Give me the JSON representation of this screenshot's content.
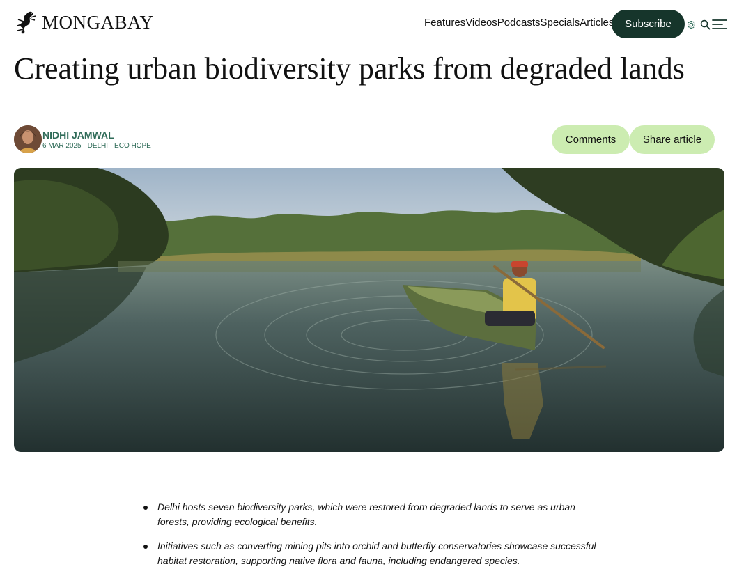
{
  "header": {
    "logo_text": "MONGABAY",
    "nav": [
      "Features",
      "Videos",
      "Podcasts",
      "Specials",
      "Articles"
    ],
    "subscribe_label": "Subscribe",
    "icons": [
      "gear-icon",
      "search-icon",
      "menu-icon"
    ]
  },
  "article": {
    "title": "Creating urban biodiversity parks from degraded lands",
    "author": "NIDHI JAMWAL",
    "date": "6 MAR 2025",
    "tags": [
      "DELHI",
      "ECO HOPE"
    ],
    "comments_label": "Comments",
    "share_label": "Share article",
    "bullets": [
      "Delhi hosts seven biodiversity parks, which were restored from degraded lands to serve as urban forests, providing ecological benefits.",
      "Initiatives such as converting mining pits into orchid and butterfly conservatories showcase successful habitat restoration, supporting native flora and fauna, including endangered species."
    ]
  },
  "colors": {
    "brand_dark": "#16352b",
    "accent_green": "#2f6b58",
    "pill_green": "#ccecb1"
  }
}
